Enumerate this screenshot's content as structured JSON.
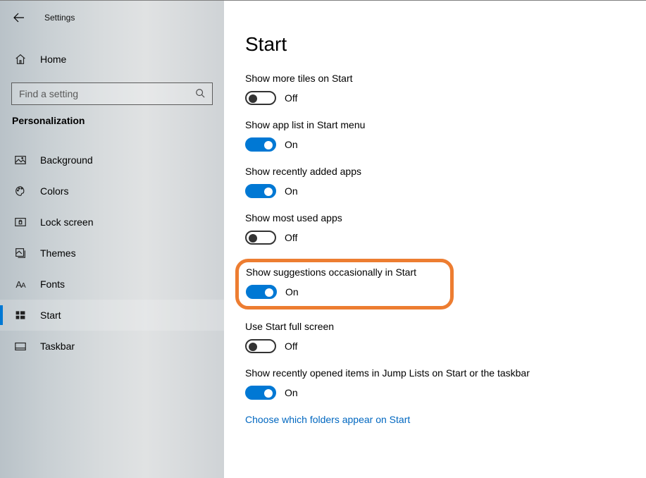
{
  "topbar": {
    "title": "Settings"
  },
  "home": {
    "label": "Home"
  },
  "search": {
    "placeholder": "Find a setting"
  },
  "section": {
    "title": "Personalization"
  },
  "nav": [
    {
      "id": "background",
      "label": "Background",
      "selected": false
    },
    {
      "id": "colors",
      "label": "Colors",
      "selected": false
    },
    {
      "id": "lock-screen",
      "label": "Lock screen",
      "selected": false
    },
    {
      "id": "themes",
      "label": "Themes",
      "selected": false
    },
    {
      "id": "fonts",
      "label": "Fonts",
      "selected": false
    },
    {
      "id": "start",
      "label": "Start",
      "selected": true
    },
    {
      "id": "taskbar",
      "label": "Taskbar",
      "selected": false
    }
  ],
  "page": {
    "title": "Start"
  },
  "settings": {
    "more_tiles": {
      "label": "Show more tiles on Start",
      "on": false,
      "state": "Off"
    },
    "app_list": {
      "label": "Show app list in Start menu",
      "on": true,
      "state": "On"
    },
    "recently_added": {
      "label": "Show recently added apps",
      "on": true,
      "state": "On"
    },
    "most_used": {
      "label": "Show most used apps",
      "on": false,
      "state": "Off"
    },
    "suggestions": {
      "label": "Show suggestions occasionally in Start",
      "on": true,
      "state": "On"
    },
    "full_screen": {
      "label": "Use Start full screen",
      "on": false,
      "state": "Off"
    },
    "jump_lists": {
      "label": "Show recently opened items in Jump Lists on Start or the taskbar",
      "on": true,
      "state": "On"
    }
  },
  "link": {
    "label": "Choose which folders appear on Start"
  }
}
